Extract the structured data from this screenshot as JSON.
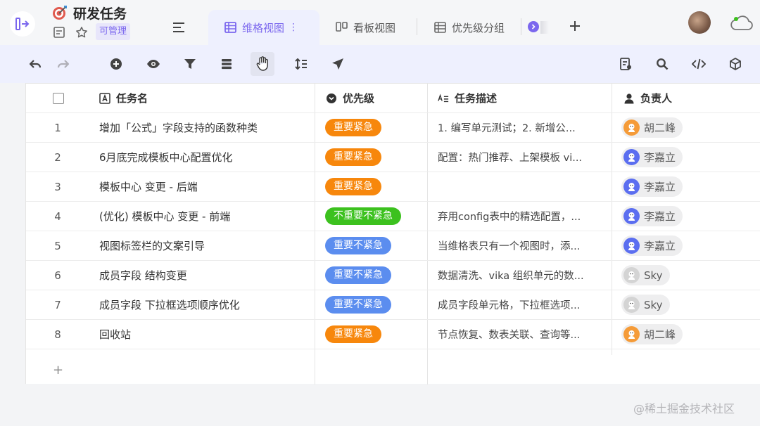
{
  "datasheet": {
    "title": "研发任务",
    "permission": "可管理",
    "icon": "dart-target-emoji"
  },
  "tabs": [
    {
      "label": "维格视图",
      "icon": "grid-view-icon",
      "active": true
    },
    {
      "label": "看板视图",
      "icon": "kanban-view-icon",
      "active": false
    },
    {
      "label": "优先级分组",
      "icon": "grid-view-icon",
      "active": false
    }
  ],
  "toolbar": {
    "left_icons": [
      "undo-icon",
      "redo-icon",
      "add-record-icon",
      "hide-fields-icon",
      "filter-icon",
      "group-icon",
      "drag-hand-icon",
      "sort-icon",
      "share-icon"
    ],
    "right_icons": [
      "form-icon",
      "search-icon",
      "api-icon",
      "widget-icon"
    ]
  },
  "columns": [
    {
      "name": "任务名",
      "icon": "text-field-icon"
    },
    {
      "name": "优先级",
      "icon": "single-select-icon"
    },
    {
      "name": "任务描述",
      "icon": "long-text-icon"
    },
    {
      "name": "负责人",
      "icon": "member-icon"
    }
  ],
  "rows": [
    {
      "num": "1",
      "task": "增加「公式」字段支持的函数种类",
      "priority": "重要紧急",
      "priority_color": "#f7870c",
      "desc": "1. 编写单元测试；2. 新增公...",
      "owner": "胡二峰",
      "owner_avatar": "orange"
    },
    {
      "num": "2",
      "task": "6月底完成模板中心配置优化",
      "priority": "重要紧急",
      "priority_color": "#f7870c",
      "desc": "配置：热门推荐、上架模板 vi...",
      "owner": "李嘉立",
      "owner_avatar": "blue"
    },
    {
      "num": "3",
      "task": "模板中心 变更 - 后端",
      "priority": "重要紧急",
      "priority_color": "#f7870c",
      "desc": "",
      "owner": "李嘉立",
      "owner_avatar": "blue"
    },
    {
      "num": "4",
      "task": "(优化) 模板中心 变更 - 前端",
      "priority": "不重要不紧急",
      "priority_color": "#3cc11e",
      "desc": "弃用config表中的精选配置，...",
      "owner": "李嘉立",
      "owner_avatar": "blue"
    },
    {
      "num": "5",
      "task": "视图标签栏的文案引导",
      "priority": "重要不紧急",
      "priority_color": "#5b8def",
      "desc": "当维格表只有一个视图时，添...",
      "owner": "李嘉立",
      "owner_avatar": "blue"
    },
    {
      "num": "6",
      "task": "成员字段 结构变更",
      "priority": "重要不紧急",
      "priority_color": "#5b8def",
      "desc": "数据清洗、vika 组织单元的数...",
      "owner": "Sky",
      "owner_avatar": "gray"
    },
    {
      "num": "7",
      "task": "成员字段 下拉框选项顺序优化",
      "priority": "重要不紧急",
      "priority_color": "#5b8def",
      "desc": "成员字段单元格，下拉框选项...",
      "owner": "Sky",
      "owner_avatar": "gray"
    },
    {
      "num": "8",
      "task": "回收站",
      "priority": "重要紧急",
      "priority_color": "#f7870c",
      "desc": "节点恢复、数表关联、查询等...",
      "owner": "胡二峰",
      "owner_avatar": "orange"
    }
  ],
  "add_row_label": "+",
  "watermark": "@稀土掘金技术社区"
}
